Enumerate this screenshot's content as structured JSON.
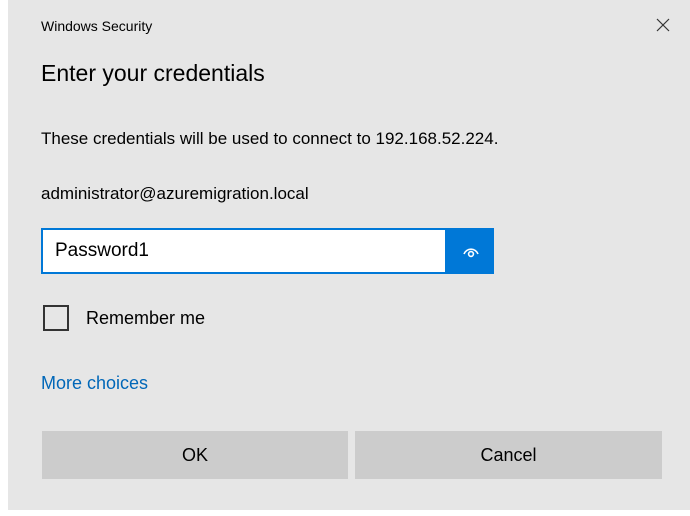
{
  "window": {
    "title": "Windows Security",
    "close_icon": "close-icon"
  },
  "dialog": {
    "heading": "Enter your credentials",
    "message": "These credentials will be used to connect to 192.168.52.224.",
    "username": "administrator@azuremigration.local"
  },
  "password_field": {
    "value": "Password1",
    "reveal_icon": "eye-reveal-icon"
  },
  "remember_me": {
    "label": "Remember me",
    "checked": false
  },
  "links": {
    "more_choices": "More choices"
  },
  "buttons": {
    "ok": "OK",
    "cancel": "Cancel"
  },
  "colors": {
    "accent": "#0078d7",
    "link": "#0067b8",
    "dialog_background": "#e6e6e6",
    "button_background": "#cccccc"
  }
}
